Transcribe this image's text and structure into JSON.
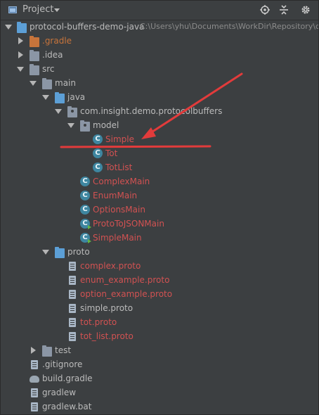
{
  "toolbar": {
    "title": "Project",
    "icons": [
      "target-icon",
      "collapse-icon",
      "settings-icon"
    ]
  },
  "tree": {
    "root": {
      "name": "protocol-buffers-demo-java",
      "path": "C:\\Users\\yhu\\Documents\\WorkDir\\Repository\\c"
    },
    "items": {
      "gradle_dir": ".gradle",
      "idea_dir": ".idea",
      "src": "src",
      "main": "main",
      "java": "java",
      "package": "com.insight.demo.protocolbuffers",
      "model": "model",
      "simple": "Simple",
      "tot": "Tot",
      "totlist": "TotList",
      "complexmain": "ComplexMain",
      "enummain": "EnumMain",
      "optionsmain": "OptionsMain",
      "prototojsonmain": "ProtoToJSONMain",
      "simplemain": "SimpleMain",
      "proto": "proto",
      "complex_proto": "complex.proto",
      "enum_example_proto": "enum_example.proto",
      "option_example_proto": "option_example.proto",
      "simple_proto": "simple.proto",
      "tot_proto": "tot.proto",
      "tot_list_proto": "tot_list.proto",
      "test": "test",
      "gitignore": ".gitignore",
      "build_gradle": "build.gradle",
      "gradlew": "gradlew",
      "gradlew_bat": "gradlew.bat"
    },
    "class_glyph": "C"
  },
  "colors": {
    "background": "#3c3f41",
    "text": "#bbbbbb",
    "modified_red": "#d25252",
    "excluded_orange": "#c7743b",
    "annotation_red": "#e23b3b"
  }
}
